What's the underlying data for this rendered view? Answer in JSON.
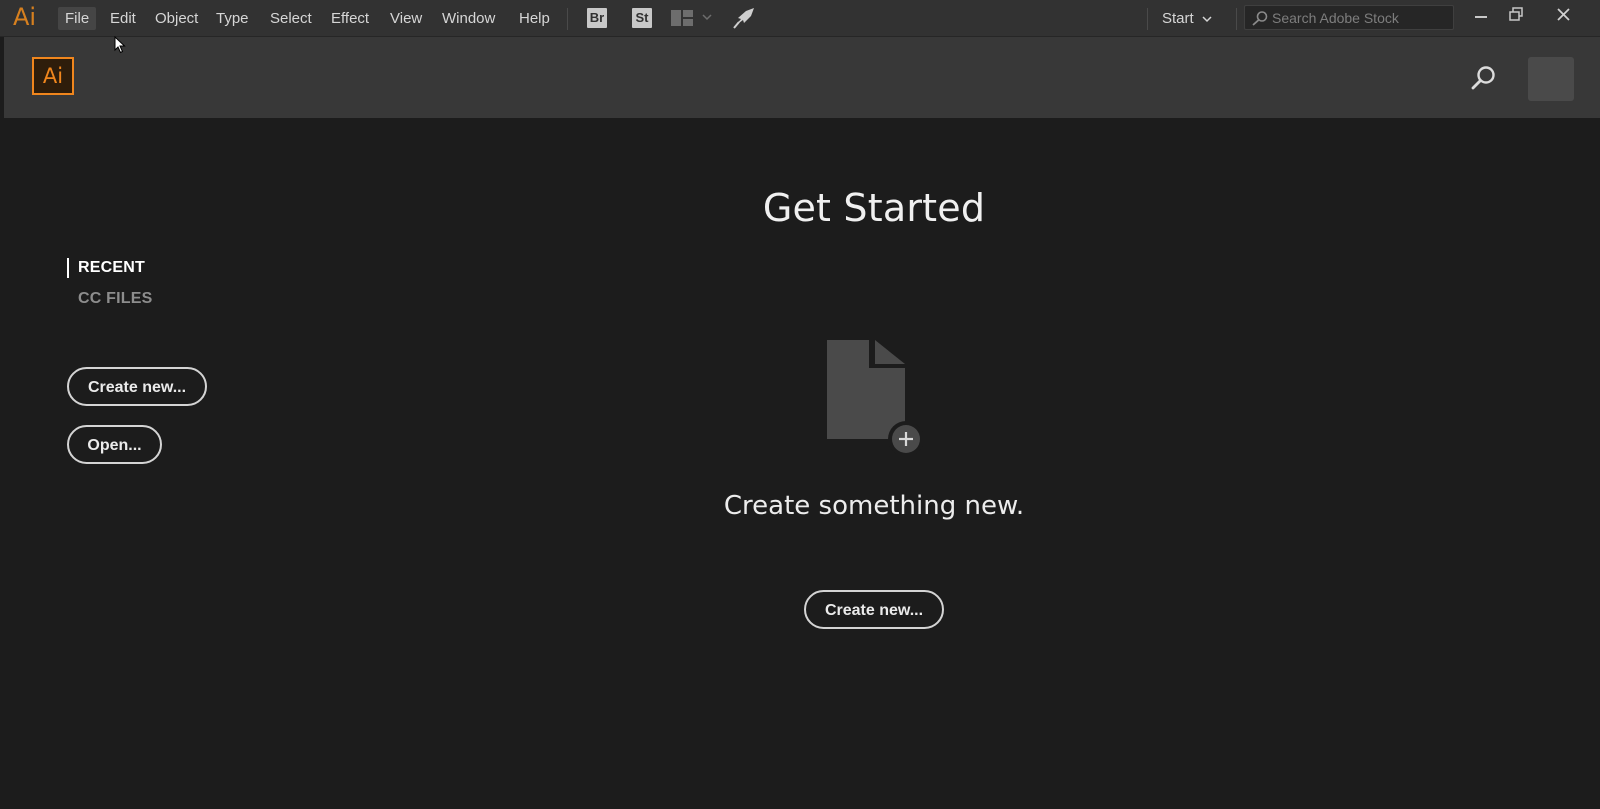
{
  "app": {
    "menu_mark": "Ai",
    "logo_text": "Ai"
  },
  "menubar": {
    "items": [
      "File",
      "Edit",
      "Object",
      "Type",
      "Select",
      "Effect",
      "View",
      "Window",
      "Help"
    ],
    "active_item": "File",
    "bridge_label": "Br",
    "stock_label": "St",
    "workspace": "Start",
    "stock_search_placeholder": "Search Adobe Stock"
  },
  "home": {
    "tabs": [
      {
        "label": "RECENT",
        "active": true
      },
      {
        "label": "CC FILES",
        "active": false
      }
    ],
    "left_create_label": "Create new...",
    "left_open_label": "Open...",
    "title": "Get Started",
    "message": "Create something new.",
    "center_create_label": "Create new..."
  },
  "colors": {
    "accent_orange": "#f0861d",
    "menubar_bg": "#323232",
    "header_bg": "#383838",
    "canvas_bg": "#1c1c1c"
  },
  "icons": {
    "header_search": "search-icon",
    "new_document": "new-document-icon",
    "add_badge": "plus-circle-icon"
  }
}
